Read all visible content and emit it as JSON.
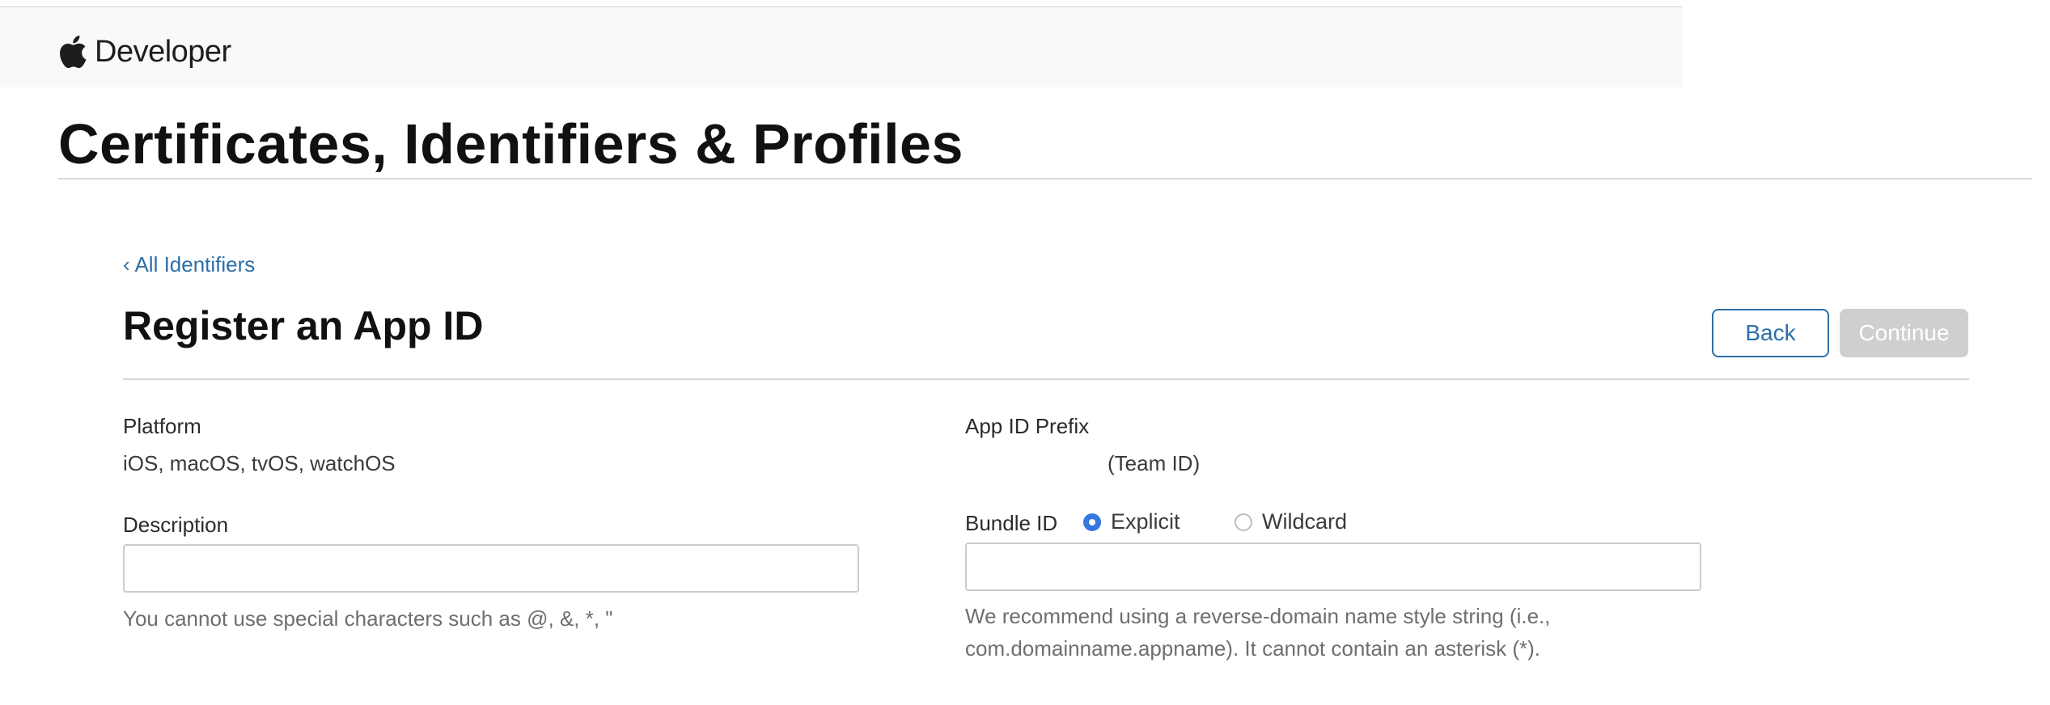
{
  "header": {
    "brand_icon": "apple-logo-icon",
    "brand_name": "Developer"
  },
  "page_title": "Certificates, Identifiers & Profiles",
  "breadcrumb": {
    "back_link": "‹ All Identifiers"
  },
  "form": {
    "title": "Register an App ID",
    "buttons": {
      "back": "Back",
      "continue": "Continue"
    },
    "platform": {
      "label": "Platform",
      "value": "iOS, macOS, tvOS, watchOS"
    },
    "app_id_prefix": {
      "label": "App ID Prefix",
      "value": "(Team ID)"
    },
    "description": {
      "label": "Description",
      "value": "",
      "placeholder": "",
      "hint": "You cannot use special characters such as @, &, *, \""
    },
    "bundle_id": {
      "label": "Bundle ID",
      "options": [
        {
          "label": "Explicit",
          "selected": true
        },
        {
          "label": "Wildcard",
          "selected": false
        }
      ],
      "value": "",
      "placeholder": "",
      "hint": "We recommend using a reverse-domain name style string (i.e., com.domainname.appname). It cannot contain an asterisk (*)."
    }
  },
  "colors": {
    "link": "#2c6fa8",
    "radio_selected": "#3478e0",
    "button_disabled": "#cfcfcf"
  }
}
